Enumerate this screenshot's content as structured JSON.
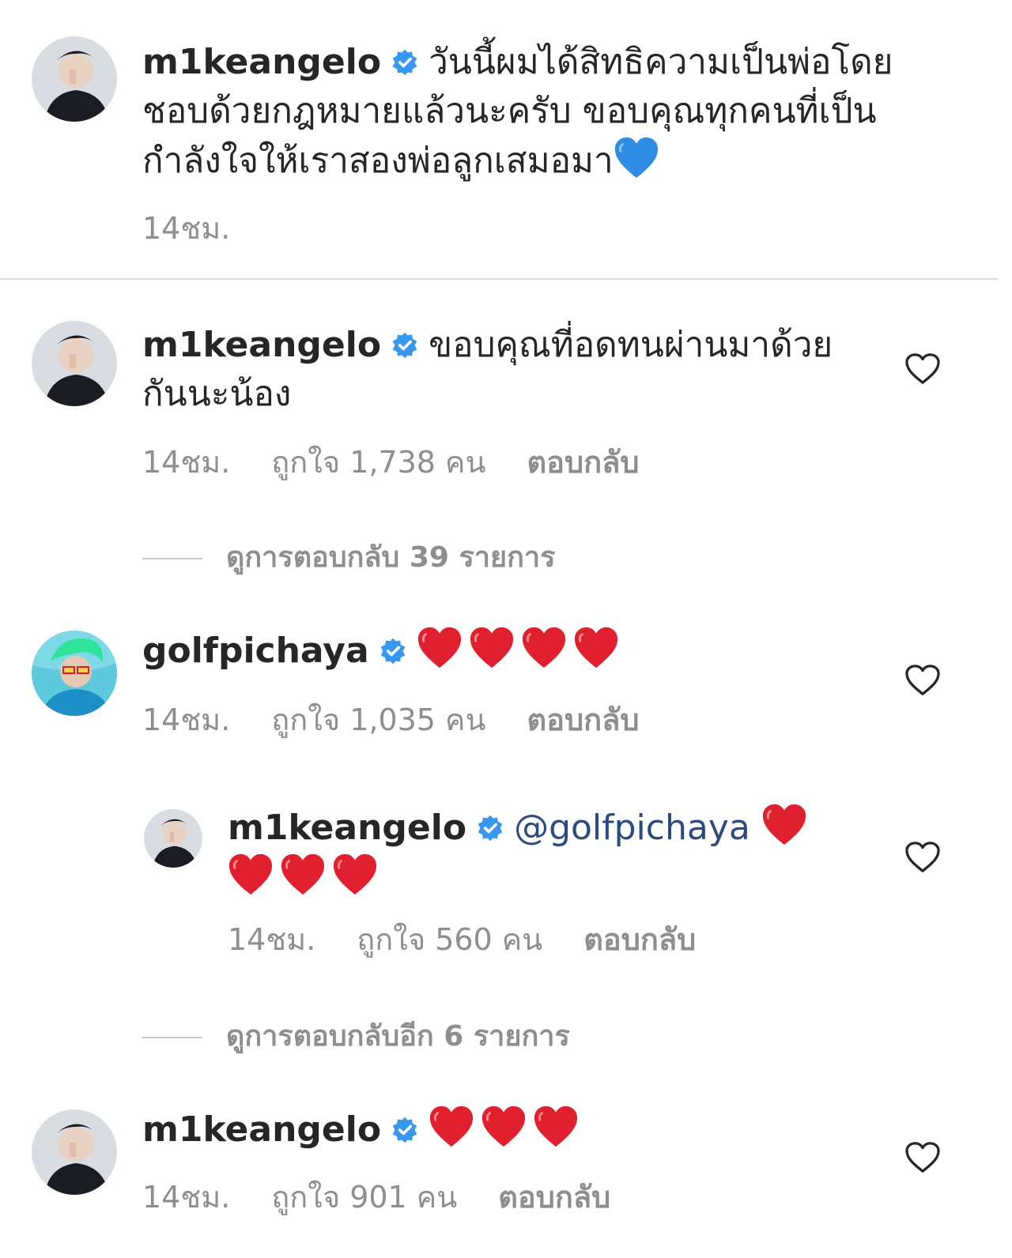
{
  "caption": {
    "username": "m1keangelo",
    "text": "วันนี้ผมได้สิทธิความเป็นพ่อโดยชอบด้วยกฎหมายแล้วนะครับ ขอบคุณทุกคนที่เป็นกำลังใจให้เราสองพ่อลูกเสมอมา",
    "emoji": "blue-heart",
    "time": "14ชม."
  },
  "comments": [
    {
      "username": "m1keangelo",
      "text": "ขอบคุณที่อดทนผ่านมาด้วยกันนะน้อง",
      "time": "14ชม.",
      "likes": "ถูกใจ 1,738 คน",
      "reply": "ตอบกลับ",
      "view_replies": "ดูการตอบกลับ 39 รายการ"
    },
    {
      "username": "golfpichaya",
      "emoji_count": 4,
      "time": "14ชม.",
      "likes": "ถูกใจ 1,035 คน",
      "reply": "ตอบกลับ",
      "reply_item": {
        "username": "m1keangelo",
        "mention": "@golfpichaya",
        "emoji_count": 4,
        "time": "14ชม.",
        "likes": "ถูกใจ 560 คน",
        "reply": "ตอบกลับ"
      },
      "view_replies": "ดูการตอบกลับอีก 6 รายการ"
    },
    {
      "username": "m1keangelo",
      "emoji_count": 3,
      "time": "14ชม.",
      "likes": "ถูกใจ 901 คน",
      "reply": "ตอบกลับ"
    }
  ],
  "colors": {
    "verified": "#3897f0",
    "meta": "#8e8e8e",
    "mention": "#2b4b80",
    "heart": "#e0202e",
    "blue_heart": "#2f8de4"
  }
}
